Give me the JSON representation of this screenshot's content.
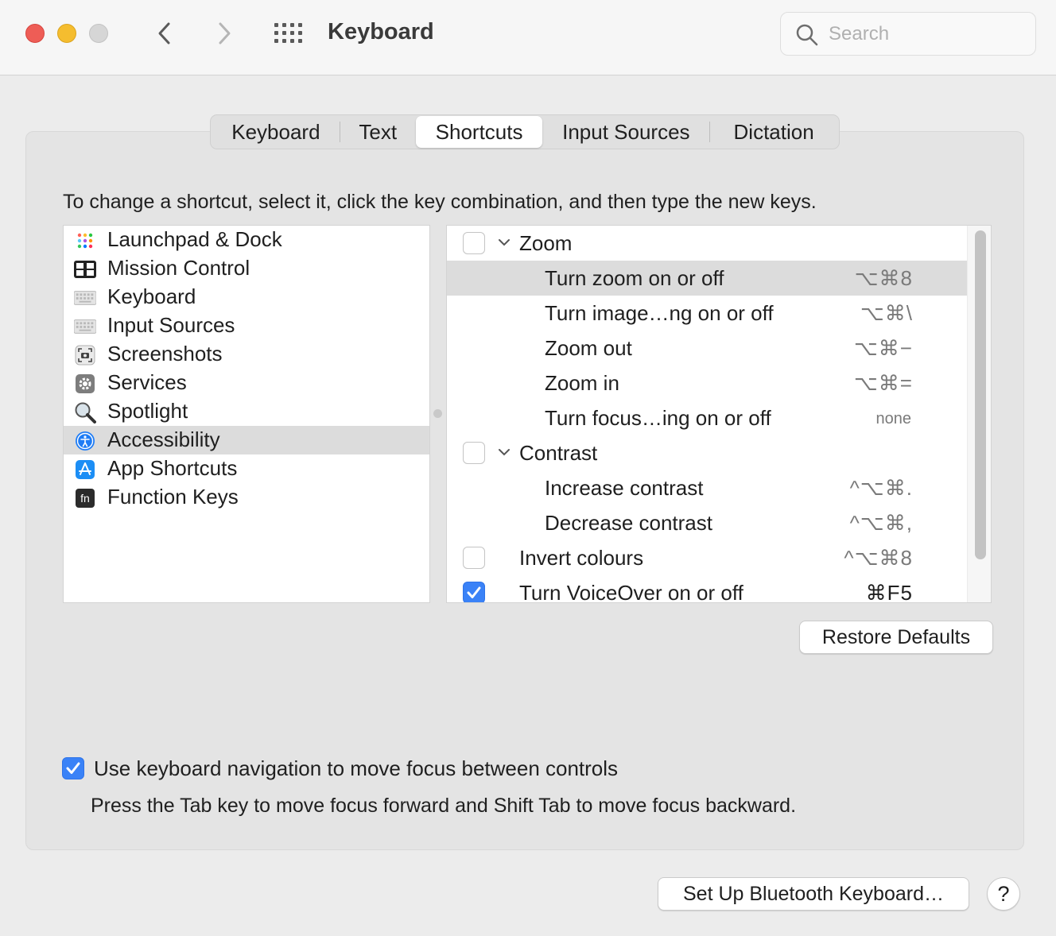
{
  "window": {
    "title": "Keyboard",
    "search_placeholder": "Search"
  },
  "tabs": [
    {
      "label": "Keyboard",
      "active": false
    },
    {
      "label": "Text",
      "active": false
    },
    {
      "label": "Shortcuts",
      "active": true
    },
    {
      "label": "Input Sources",
      "active": false
    },
    {
      "label": "Dictation",
      "active": false
    }
  ],
  "instructions": "To change a shortcut, select it, click the key combination, and then type the new keys.",
  "categories": [
    {
      "label": "Launchpad & Dock",
      "icon": "launchpad-icon"
    },
    {
      "label": "Mission Control",
      "icon": "mission-control-icon"
    },
    {
      "label": "Keyboard",
      "icon": "keyboard-icon"
    },
    {
      "label": "Input Sources",
      "icon": "input-sources-icon"
    },
    {
      "label": "Screenshots",
      "icon": "screenshot-icon"
    },
    {
      "label": "Services",
      "icon": "gear-icon"
    },
    {
      "label": "Spotlight",
      "icon": "magnifier-icon"
    },
    {
      "label": "Accessibility",
      "icon": "accessibility-icon",
      "selected": true
    },
    {
      "label": "App Shortcuts",
      "icon": "app-store-icon"
    },
    {
      "label": "Function Keys",
      "icon": "fn-key-icon"
    }
  ],
  "shortcuts": [
    {
      "label": "Zoom",
      "key": "",
      "group": true,
      "checked": false
    },
    {
      "label": "Turn zoom on or off",
      "key": "⌥⌘8",
      "selected": true
    },
    {
      "label": "Turn image…ng on or off",
      "key": "⌥⌘\\"
    },
    {
      "label": "Zoom out",
      "key": "⌥⌘−"
    },
    {
      "label": "Zoom in",
      "key": "⌥⌘="
    },
    {
      "label": "Turn focus…ing on or off",
      "key": "none"
    },
    {
      "label": "Contrast",
      "key": "",
      "group": true,
      "checked": false
    },
    {
      "label": "Increase contrast",
      "key": "^⌥⌘."
    },
    {
      "label": "Decrease contrast",
      "key": "^⌥⌘,"
    },
    {
      "label": "Invert colours",
      "key": "^⌥⌘8",
      "checkbox": true,
      "checked": false
    },
    {
      "label": "Turn VoiceOver on or off",
      "key": "⌘F5",
      "checkbox": true,
      "checked": true
    }
  ],
  "buttons": {
    "restore": "Restore Defaults",
    "bluetooth": "Set Up Bluetooth Keyboard…",
    "help": "?"
  },
  "keyboard_navigation": {
    "label": "Use keyboard navigation to move focus between controls",
    "checked": true,
    "hint": "Press the Tab key to move focus forward and Shift Tab to move focus backward."
  },
  "colors": {
    "accent": "#3a82f7",
    "selection": "#dcdcdc",
    "close": "#ee5d56",
    "minimize": "#f5bd2f"
  }
}
